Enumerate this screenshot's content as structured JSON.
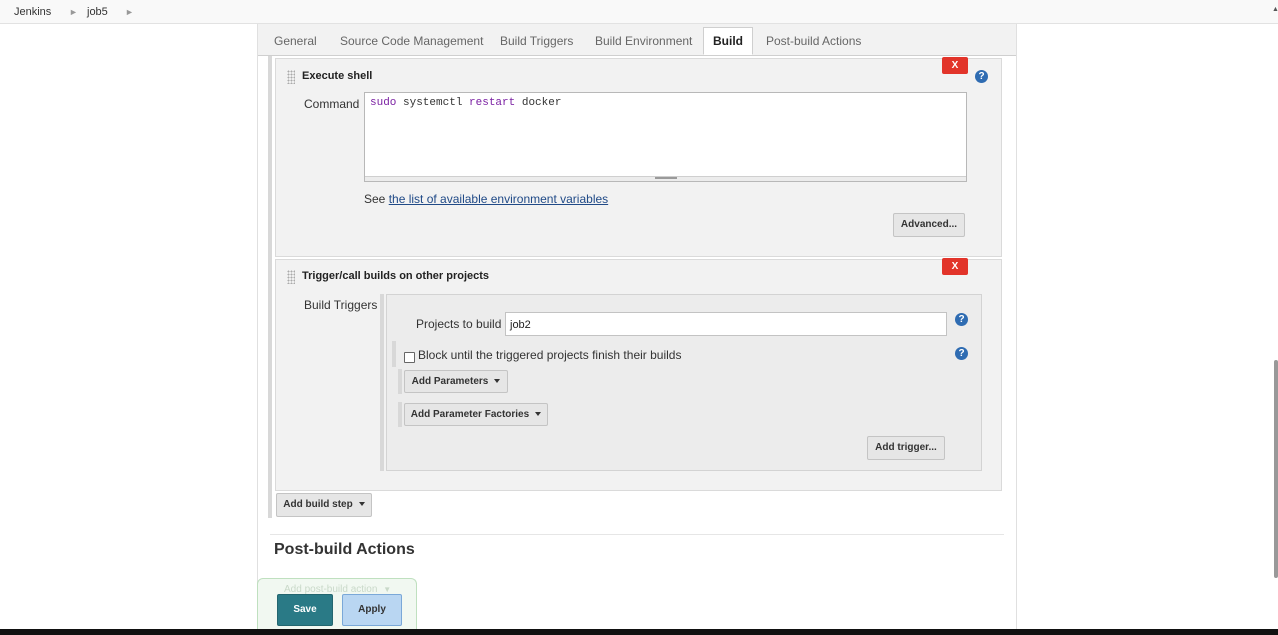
{
  "breadcrumb": {
    "root": "Jenkins",
    "job": "job5"
  },
  "tabs": [
    {
      "label": "General"
    },
    {
      "label": "Source Code Management"
    },
    {
      "label": "Build Triggers"
    },
    {
      "label": "Build Environment"
    },
    {
      "label": "Build",
      "active": true
    },
    {
      "label": "Post-build Actions"
    }
  ],
  "execute_shell": {
    "title": "Execute shell",
    "delete_label": "X",
    "help_label": "?",
    "command_label": "Command",
    "command_tokens": {
      "t1": "sudo",
      "t2": " systemctl ",
      "t3": "restart",
      "t4": " docker"
    },
    "see_text": "See",
    "env_link": "the list of available environment variables",
    "advanced_label": "Advanced..."
  },
  "trigger_builds": {
    "title": "Trigger/call builds on other projects",
    "delete_label": "X",
    "build_triggers_label": "Build Triggers",
    "projects_label": "Projects to build",
    "projects_value": "job2",
    "help_label": "?",
    "block_label": "Block until the triggered projects finish their builds",
    "add_parameters_label": "Add Parameters",
    "add_parameter_factories_label": "Add Parameter Factories",
    "add_trigger_label": "Add trigger..."
  },
  "add_build_step_label": "Add build step",
  "post_build": {
    "heading": "Post-build Actions",
    "add_action_label": "Add post-build action"
  },
  "actions": {
    "save": "Save",
    "apply": "Apply"
  },
  "colors": {
    "delete_red": "#e2342a",
    "help_blue": "#2f6cb2",
    "save_teal": "#2a7a86",
    "apply_blue": "#b9d6f2",
    "link_blue": "#204a87"
  }
}
